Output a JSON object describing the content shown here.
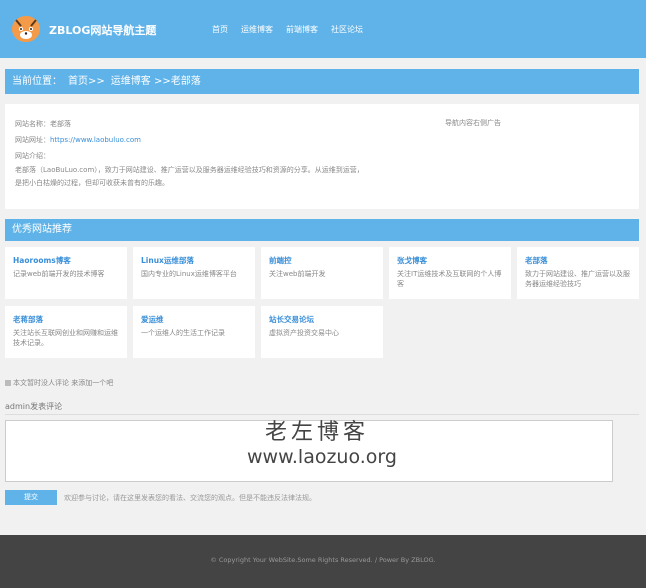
{
  "header": {
    "site_title": "ZBLOG网站导航主题",
    "nav": [
      "首页",
      "运维博客",
      "前端博客",
      "社区论坛"
    ]
  },
  "breadcrumb": {
    "label": "当前位置：",
    "home": "首页>>",
    "category": "运维博客 >>",
    "current": "老部落"
  },
  "site_info": {
    "name": "网站名称：老部落",
    "url_label": "网站网址：",
    "url": "https://www.laobuluo.com",
    "intro_label": "网站介绍：",
    "intro": "老部落（LaoBuLuo.com），致力于网站建设、推广运营以及服务器运维经验技巧和资源的分享。从运维到运营，是把小白枯燥的过程，但却可收获未曾有的乐趣。",
    "ad": "导航内容右侧广告"
  },
  "recommend": {
    "title": "优秀网站推荐",
    "cards": [
      {
        "title": "Haorooms博客",
        "desc": "记录web前端开发的技术博客"
      },
      {
        "title": "Linux运维部落",
        "desc": "国内专业的Linux运维博客平台"
      },
      {
        "title": "前端控",
        "desc": "关注web前端开发"
      },
      {
        "title": "张戈博客",
        "desc": "关注IT运维技术及互联网的个人博客"
      },
      {
        "title": "老部落",
        "desc": "致力于网站建设、推广运营以及服务器运维经验技巧"
      },
      {
        "title": "老蒋部落",
        "desc": "关注站长互联网创业和网赚和运维技术记录。"
      },
      {
        "title": "爱运维",
        "desc": "一个运维人的生活工作记录"
      },
      {
        "title": "站长交易论坛",
        "desc": "虚拟资产投资交易中心"
      }
    ]
  },
  "comments": {
    "note": "本文暂时没人评论 来添加一个吧",
    "heading": "admin发表评论",
    "watermark_cn": "老左博客",
    "watermark_url": "www.laozuo.org",
    "submit": "提交",
    "hint": "欢迎参与讨论，请在这里发表您的看法、交流您的观点。但是不能违反法律法规。"
  },
  "footer": {
    "text": "© Copyright Your WebSite.Some Rights Reserved. / Power By ZBLOG."
  },
  "colors": {
    "accent": "#5fb3e8",
    "link": "#3a8fd8",
    "footer_bg": "#444444"
  }
}
